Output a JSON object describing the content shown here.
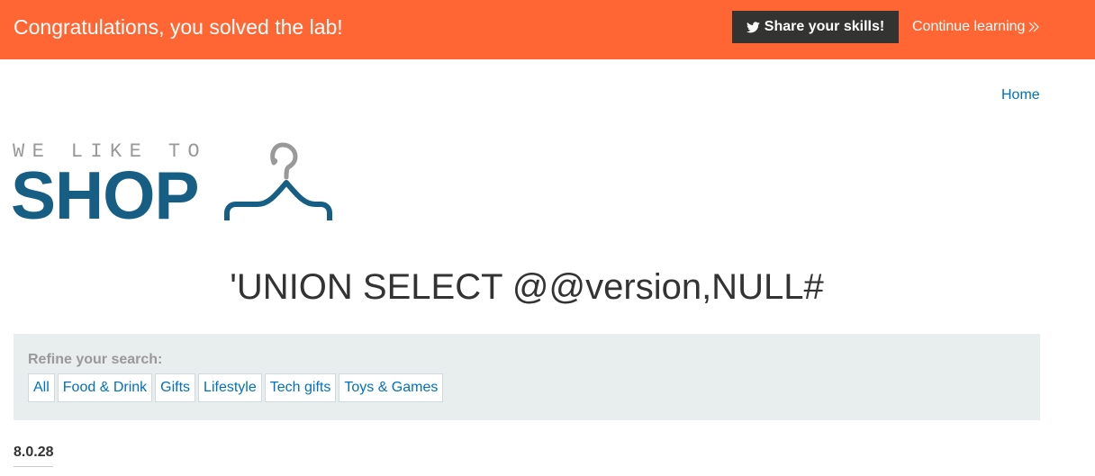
{
  "banner": {
    "message": "Congratulations, you solved the lab!",
    "share_label": "Share your skills!",
    "continue_label": "Continue learning",
    "bg_color": "#ff6633"
  },
  "nav": {
    "home_label": "Home"
  },
  "logo": {
    "top_text": "WE LIKE TO",
    "main_text": "SHOP",
    "icon": "hanger-icon"
  },
  "page_title": "'UNION SELECT @@version,NULL#",
  "refine": {
    "label": "Refine your search:",
    "filters": [
      "All",
      "Food & Drink",
      "Gifts",
      "Lifestyle",
      "Tech gifts",
      "Toys & Games"
    ]
  },
  "results": {
    "version": "8.0.28"
  }
}
